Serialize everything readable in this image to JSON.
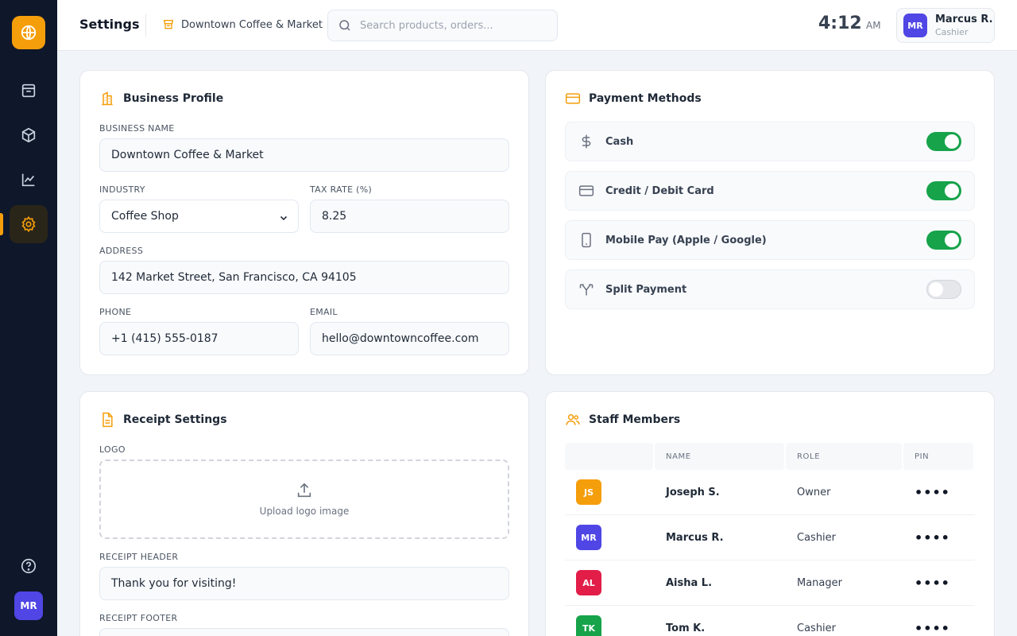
{
  "colors": {
    "accent": "#f59e0b",
    "sidebar": "#0f172a",
    "toggle_on": "#16a34a",
    "avatar": "#4f46e5"
  },
  "sidebar": {
    "logo_icon": "globe-icon",
    "nav": [
      {
        "icon": "register-icon",
        "active": false
      },
      {
        "icon": "box-icon",
        "active": false
      },
      {
        "icon": "chart-icon",
        "active": false
      },
      {
        "icon": "gear-icon",
        "active": true
      }
    ],
    "help_icon": "help-icon",
    "avatar_initials": "MR"
  },
  "header": {
    "title": "Settings",
    "store_name": "Downtown Coffee & Market",
    "search_placeholder": "Search products, orders...",
    "time": "4:12",
    "ampm": "AM",
    "user": {
      "initials": "MR",
      "name": "Marcus R.",
      "role": "Cashier"
    }
  },
  "business_profile": {
    "title": "Business Profile",
    "business_name_label": "Business Name",
    "business_name": "Downtown Coffee & Market",
    "industry_label": "Industry",
    "industry": "Coffee Shop",
    "tax_rate_label": "Tax Rate (%)",
    "tax_rate": "8.25",
    "address_label": "Address",
    "address": "142 Market Street, San Francisco, CA 94105",
    "phone_label": "Phone",
    "phone": "+1 (415) 555-0187",
    "email_label": "Email",
    "email": "hello@downtowncoffee.com"
  },
  "payment_methods": {
    "title": "Payment Methods",
    "items": [
      {
        "label": "Cash",
        "icon": "dollar-icon",
        "enabled": true
      },
      {
        "label": "Credit / Debit Card",
        "icon": "card-icon",
        "enabled": true
      },
      {
        "label": "Mobile Pay (Apple / Google)",
        "icon": "phone-icon",
        "enabled": true
      },
      {
        "label": "Split Payment",
        "icon": "split-icon",
        "enabled": false
      }
    ]
  },
  "receipt_settings": {
    "title": "Receipt Settings",
    "logo_label": "Logo",
    "upload_text": "Upload logo image",
    "header_label": "Receipt Header",
    "header_value": "Thank you for visiting!",
    "footer_label": "Receipt Footer"
  },
  "staff": {
    "title": "Staff Members",
    "columns": [
      "",
      "Name",
      "Role",
      "PIN"
    ],
    "rows": [
      {
        "initials": "JS",
        "name": "Joseph S.",
        "role": "Owner",
        "pin": "••••",
        "color": "#f59e0b"
      },
      {
        "initials": "MR",
        "name": "Marcus R.",
        "role": "Cashier",
        "pin": "••••",
        "color": "#4f46e5"
      },
      {
        "initials": "AL",
        "name": "Aisha L.",
        "role": "Manager",
        "pin": "••••",
        "color": "#e11d48"
      },
      {
        "initials": "TK",
        "name": "Tom K.",
        "role": "Cashier",
        "pin": "••••",
        "color": "#16a34a"
      }
    ]
  }
}
